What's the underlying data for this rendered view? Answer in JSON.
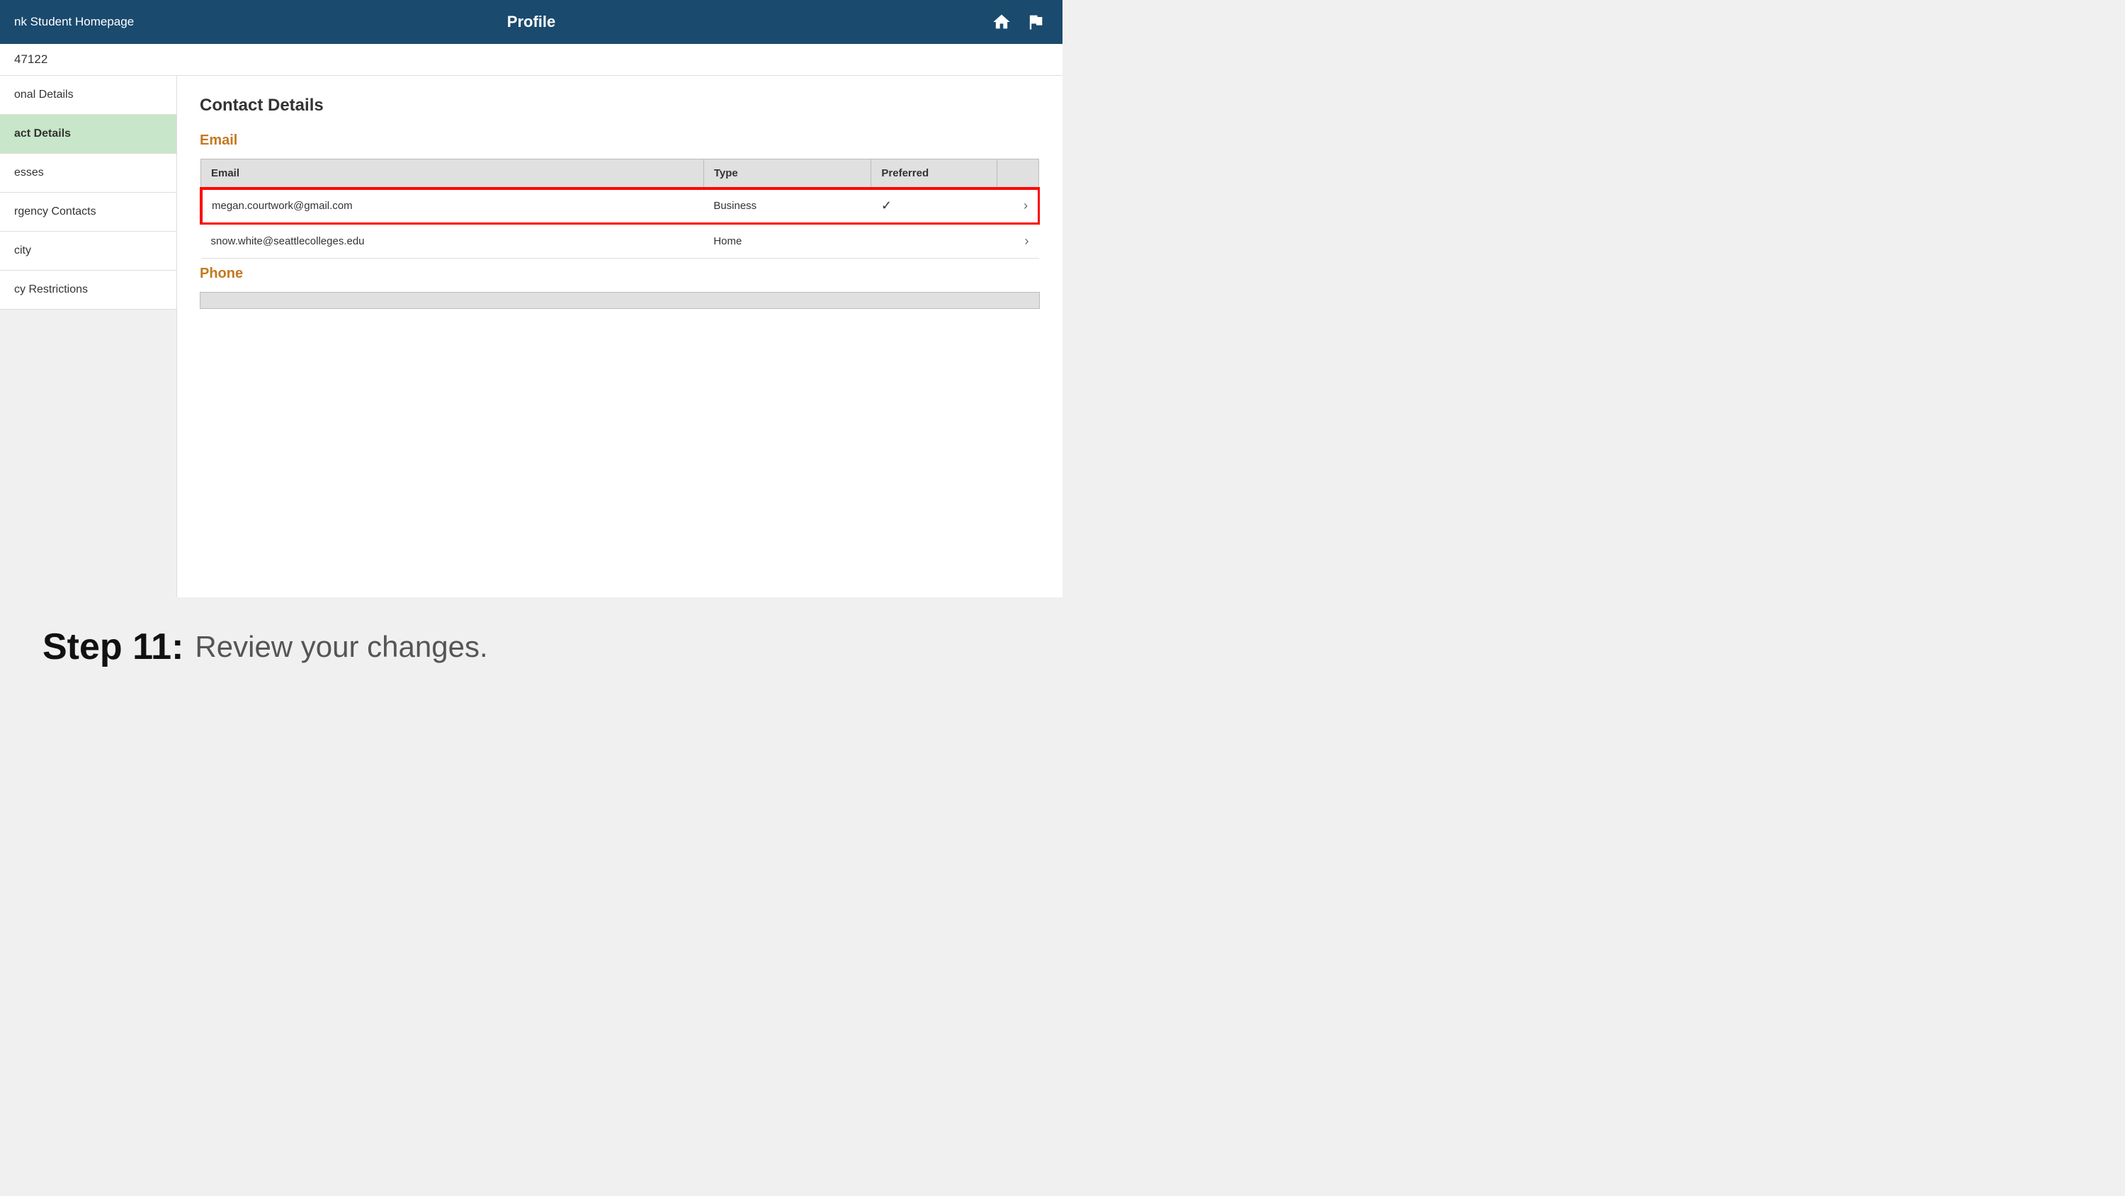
{
  "header": {
    "nav_link": "nk Student Homepage",
    "title": "Profile",
    "home_icon": "🏠",
    "flag_icon": "🚩"
  },
  "student": {
    "id": "47122"
  },
  "sidebar": {
    "items": [
      {
        "label": "onal Details",
        "active": false
      },
      {
        "label": "act Details",
        "active": true
      },
      {
        "label": "esses",
        "active": false
      },
      {
        "label": "rgency Contacts",
        "active": false
      },
      {
        "label": "city",
        "active": false
      },
      {
        "label": "cy Restrictions",
        "active": false
      }
    ]
  },
  "content": {
    "title": "Contact Details",
    "email_section": {
      "header": "Email",
      "columns": [
        "Email",
        "Type",
        "Preferred"
      ],
      "rows": [
        {
          "email": "megan.courtwork@gmail.com",
          "type": "Business",
          "preferred": true,
          "highlighted": true
        },
        {
          "email": "snow.white@seattlecolleges.edu",
          "type": "Home",
          "preferred": false,
          "highlighted": false
        }
      ]
    },
    "phone_section": {
      "header": "Phone"
    }
  },
  "step": {
    "number": "Step 11:",
    "text": "Review your changes."
  }
}
